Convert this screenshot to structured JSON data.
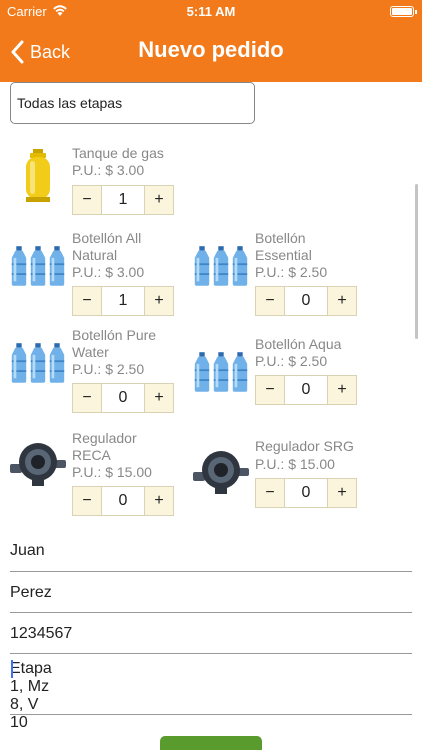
{
  "status_bar": {
    "carrier": "Carrier",
    "time": "5:11 AM"
  },
  "nav": {
    "back_label": "Back",
    "title": "Nuevo pedido"
  },
  "stage_filter": {
    "selected": "Todas las etapas"
  },
  "products": [
    {
      "name": "Tanque de gas",
      "price": "P.U.: $ 3.00",
      "qty": "1",
      "icon": "gas-tank-icon"
    },
    {
      "name": "Botellón All Natural",
      "price": "P.U.: $ 3.00",
      "qty": "1",
      "icon": "water-jugs-icon"
    },
    {
      "name": "Botellón Essential",
      "price": "P.U.: $ 2.50",
      "qty": "0",
      "icon": "water-jugs-icon"
    },
    {
      "name": "Botellón Pure Water",
      "price": "P.U.: $ 2.50",
      "qty": "0",
      "icon": "water-jugs-icon"
    },
    {
      "name": "Botellón Aqua",
      "price": "P.U.: $ 2.50",
      "qty": "0",
      "icon": "water-jugs-icon"
    },
    {
      "name": "Regulador RECA",
      "price": "P.U.: $ 15.00",
      "qty": "0",
      "icon": "gas-regulator-icon"
    },
    {
      "name": "Regulador SRG",
      "price": "P.U.: $ 15.00",
      "qty": "0",
      "icon": "gas-regulator-icon"
    }
  ],
  "stepper": {
    "minus": "−",
    "plus": "+"
  },
  "form": {
    "first_name": "Juan",
    "last_name": "Perez",
    "phone": "1234567",
    "address": "Etapa 1, Mz 8, V 10"
  },
  "colors": {
    "accent": "#f27a1a",
    "stepper_bg": "#fbf5dd",
    "submit": "#5a9b2e",
    "cursor": "#3e6ff4"
  }
}
